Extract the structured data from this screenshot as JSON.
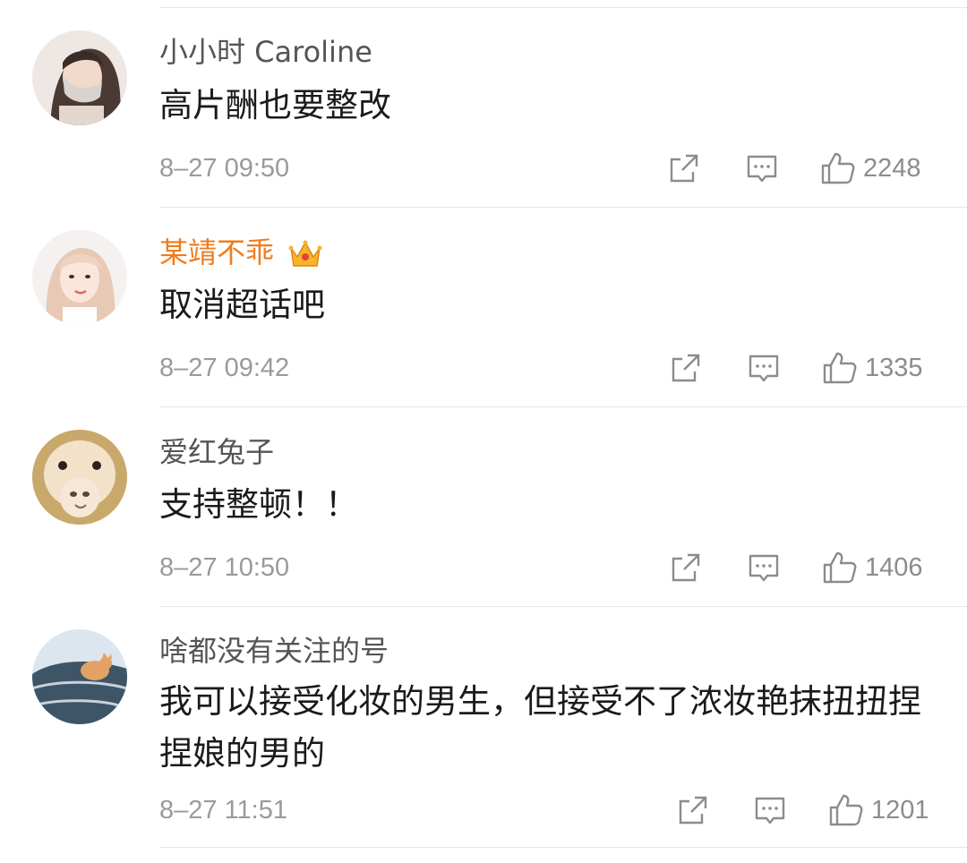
{
  "comments": [
    {
      "username": "小小时 Caroline",
      "vip": false,
      "avatar": "avatar-woman-mask",
      "text": "高片酬也要整改",
      "time": "8–27 09:50",
      "likes": "2248"
    },
    {
      "username": "某靖不乖",
      "vip": true,
      "vip_badge": "crown-icon",
      "avatar": "avatar-blonde-girl",
      "text": "取消超话吧",
      "time": "8–27 09:42",
      "likes": "1335"
    },
    {
      "username": "爱红兔子",
      "vip": false,
      "avatar": "avatar-alpaca",
      "text": "支持整顿！！",
      "time": "8–27 10:50",
      "likes": "1406"
    },
    {
      "username": "啥都没有关注的号",
      "vip": false,
      "avatar": "avatar-cat-car",
      "text": "我可以接受化妆的男生，但接受不了浓妆艳抹扭扭捏捏娘的男的",
      "time": "8–27 11:51",
      "likes": "1201"
    }
  ],
  "icons": {
    "share": "share-icon",
    "reply": "comment-icon",
    "like": "thumbs-up-icon"
  },
  "colors": {
    "vip_name": "#f07c1e",
    "name": "#555555",
    "text": "#1a1a1a",
    "meta": "#9a9a9a",
    "divider": "#e6e6e6"
  }
}
